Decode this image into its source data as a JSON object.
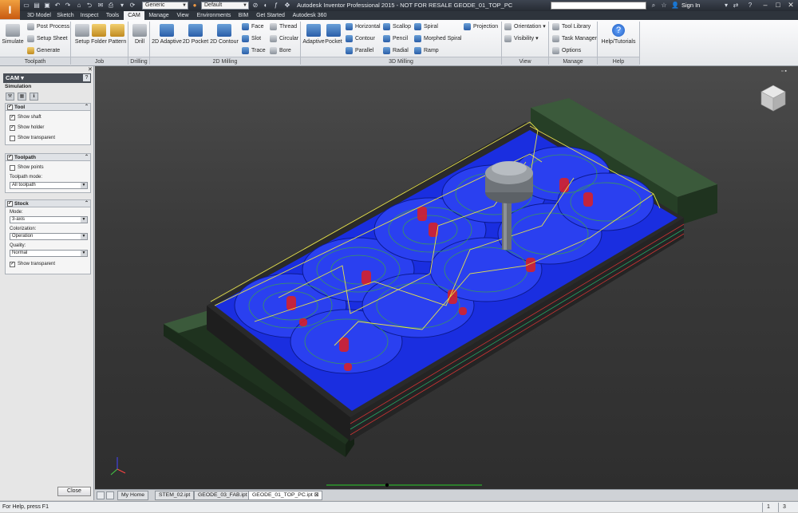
{
  "app": {
    "logo_letter": "I",
    "title": "Autodesk Inventor Professional 2015 - NOT FOR RESALE   GEODE_01_TOP_PC",
    "material": "Generic",
    "appearance": "Default",
    "sign_in": "Sign In"
  },
  "tabs": [
    "3D Model",
    "Sketch",
    "Inspect",
    "Tools",
    "CAM",
    "Manage",
    "View",
    "Environments",
    "BIM",
    "Get Started",
    "Autodesk 360"
  ],
  "active_tab": "CAM",
  "ribbon": {
    "toolpath": {
      "label": "Toolpath",
      "simulate": "Simulate",
      "post_process": "Post Process",
      "setup_sheet": "Setup Sheet",
      "generate": "Generate"
    },
    "job": {
      "label": "Job",
      "setup": "Setup",
      "folder": "Folder",
      "pattern": "Pattern"
    },
    "drilling": {
      "label": "Drilling",
      "drill": "Drill"
    },
    "milling2d": {
      "label": "2D Milling",
      "adaptive": "2D Adaptive",
      "pocket": "2D Pocket",
      "contour": "2D Contour",
      "face": "Face",
      "slot": "Slot",
      "trace": "Trace",
      "thread": "Thread",
      "circular": "Circular",
      "bore": "Bore"
    },
    "milling3d": {
      "label": "3D Milling",
      "adaptive": "Adaptive",
      "pocket": "Pocket",
      "horizontal": "Horizontal",
      "contour": "Contour",
      "parallel": "Parallel",
      "scallop": "Scallop",
      "pencil": "Pencil",
      "radial": "Radial",
      "spiral": "Spiral",
      "morphed_spiral": "Morphed Spiral",
      "ramp": "Ramp",
      "projection": "Projection"
    },
    "view": {
      "label": "View",
      "orientation": "Orientation",
      "visibility": "Visibility"
    },
    "manage": {
      "label": "Manage",
      "tool_library": "Tool Library",
      "task_manager": "Task Manager",
      "options": "Options"
    },
    "help": {
      "label": "Help",
      "help_tutorials": "Help/Tutorials"
    }
  },
  "panel": {
    "title": "CAM",
    "subtitle": "Simulation",
    "help": "?",
    "tool": {
      "header": "Tool",
      "show_shaft": "Show shaft",
      "show_holder": "Show holder",
      "show_transparent": "Show transparent"
    },
    "toolpath": {
      "header": "Toolpath",
      "show_points": "Show points",
      "mode_label": "Toolpath mode:",
      "mode_value": "All toolpath"
    },
    "stock": {
      "header": "Stock",
      "mode_label": "Mode:",
      "mode_value": "3-axis",
      "color_label": "Colorization:",
      "color_value": "Operation",
      "quality_label": "Quality:",
      "quality_value": "Normal",
      "show_transparent": "Show transparent"
    },
    "close": "Close"
  },
  "doc_tabs": [
    "My Home",
    "STEM_02.ipt",
    "GEODE_03_FAB.ipt",
    "GEODE_01_TOP_PC.ipt"
  ],
  "active_doc": "GEODE_01_TOP_PC.ipt",
  "status": {
    "text": "For Help, press F1",
    "count1": "1",
    "count2": "3"
  },
  "colors": {
    "toolpath_yellow": "#e6e24a",
    "stock_blue": "#1a2ee0",
    "holes_red": "#e02020",
    "fixture_green": "#2c4a2c",
    "toolpath_green": "#3fa83f"
  }
}
